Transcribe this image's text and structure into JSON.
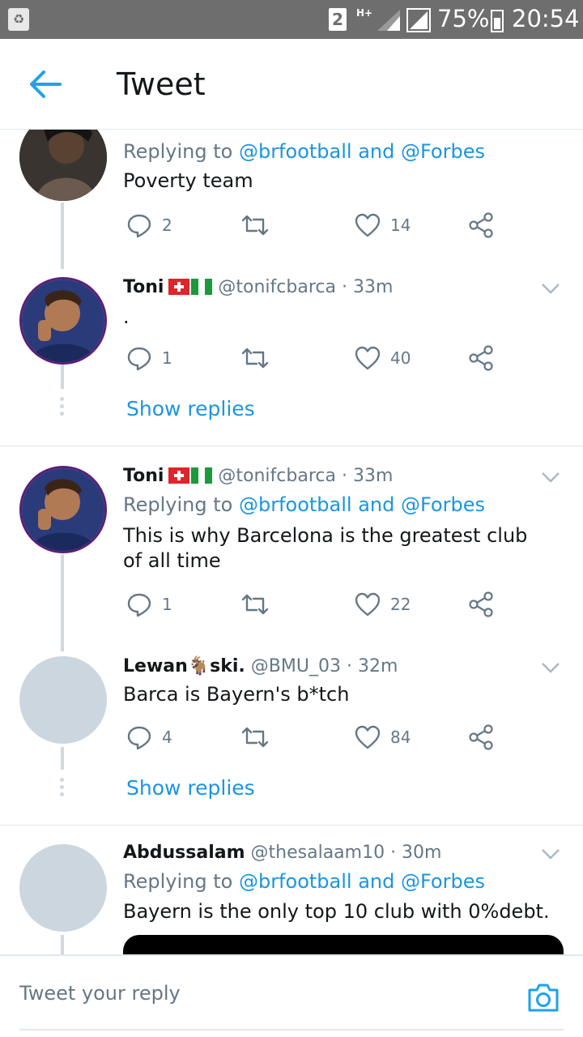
{
  "status_bar": {
    "sim": "2",
    "network": "H+",
    "battery": "75%",
    "time": "20:54"
  },
  "header": {
    "title": "Tweet"
  },
  "tweets": [
    {
      "replying_prefix": "Replying to",
      "replying_links": "@brfootball and @Forbes",
      "text": "Poverty team",
      "replies": "2",
      "likes": "14"
    },
    {
      "name": "Toni",
      "handle": "@tonifcbarca · 33m",
      "text": ".",
      "replies": "1",
      "likes": "40"
    },
    {
      "name": "Toni",
      "handle": "@tonifcbarca · 33m",
      "replying_prefix": "Replying to",
      "replying_links": "@brfootball and @Forbes",
      "text": "This is why Barcelona is the greatest club of all time",
      "replies": "1",
      "likes": "22"
    },
    {
      "name": "Lewan🐐ski.",
      "handle": "@BMU_03 · 32m",
      "text": "Barca is Bayern's b*tch",
      "replies": "4",
      "likes": "84"
    },
    {
      "name": "Abdussalam",
      "handle": "@thesalaam10 · 30m",
      "replying_prefix": "Replying to",
      "replying_links": "@brfootball and @Forbes",
      "text": "Bayern is the only top 10 club with 0%debt."
    }
  ],
  "show_replies_label": "Show replies",
  "reply_bar": {
    "placeholder": "Tweet your reply"
  },
  "colors": {
    "link": "#1b95e0",
    "secondary": "#657786",
    "thread_line": "#cfd9de"
  },
  "icons": [
    "back-arrow-icon",
    "reply-icon",
    "retweet-icon",
    "like-icon",
    "share-icon",
    "chevron-down-icon",
    "camera-icon"
  ]
}
